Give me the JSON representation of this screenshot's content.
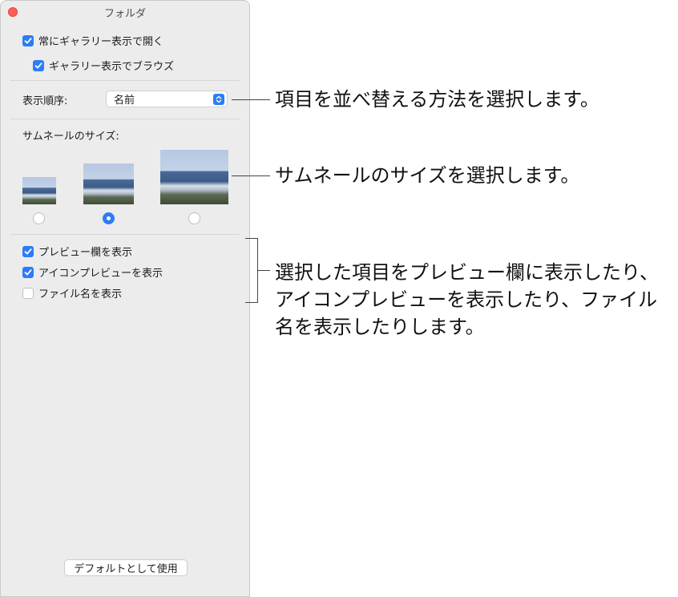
{
  "window": {
    "title": "フォルダ",
    "always_open_gallery": {
      "label": "常にギャラリー表示で開く",
      "checked": true
    },
    "browse_gallery": {
      "label": "ギャラリー表示でブラウズ",
      "checked": true
    },
    "sort_label": "表示順序:",
    "sort_value": "名前",
    "thumb_size_label": "サムネールのサイズ:",
    "thumb_sizes": [
      {
        "size": "small",
        "selected": false
      },
      {
        "size": "medium",
        "selected": true
      },
      {
        "size": "large",
        "selected": false
      }
    ],
    "show_preview_pane": {
      "label": "プレビュー欄を表示",
      "checked": true
    },
    "show_icon_preview": {
      "label": "アイコンプレビューを表示",
      "checked": true
    },
    "show_file_name": {
      "label": "ファイル名を表示",
      "checked": false
    },
    "default_button": "デフォルトとして使用"
  },
  "callouts": {
    "sort": "項目を並べ替える方法を選択します。",
    "thumb": "サムネールのサイズを選択します。",
    "display_line1": "選択した項目をプレビュー欄に表示したり、",
    "display_line2": "アイコンプレビューを表示したり、ファイル",
    "display_line3": "名を表示したりします。"
  },
  "colors": {
    "accent": "#2c7cf6",
    "close": "#fe5f57",
    "window_bg": "#ececec"
  }
}
